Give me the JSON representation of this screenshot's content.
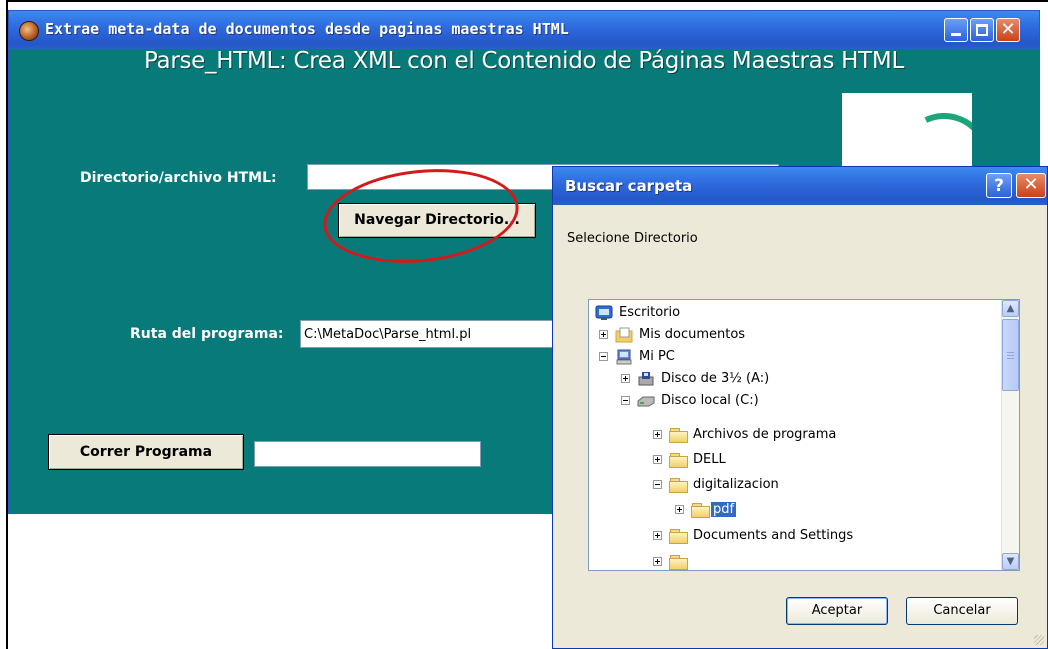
{
  "main_window": {
    "title": "Extrae meta-data de documentos desde paginas maestras HTML",
    "heading": "Parse_HTML: Crea XML con el Contenido de Páginas Maestras HTML",
    "dir_label": "Directorio/archivo HTML:",
    "dir_value": "",
    "browse_button": "Navegar Directorio...",
    "path_label": "Ruta del programa:",
    "path_value": "C:\\MetaDoc\\Parse_html.pl",
    "run_button": "Correr Programa",
    "run_status": "",
    "colors": {
      "client_bg": "#087a7a",
      "titlebar": "#2e6ce0",
      "highlight_oval": "#d31a1a"
    }
  },
  "dialog": {
    "title": "Buscar carpeta",
    "help_glyph": "?",
    "prompt": "Selecione Directorio",
    "tree": [
      {
        "label": "Escritorio",
        "icon": "desktop-icon",
        "expander": "none"
      },
      {
        "label": "Mis documentos",
        "icon": "my-documents-icon",
        "expander": "plus"
      },
      {
        "label": "Mi PC",
        "icon": "my-computer-icon",
        "expander": "minus"
      },
      {
        "label": "Disco de 3½ (A:)",
        "icon": "floppy-drive-icon",
        "expander": "plus"
      },
      {
        "label": "Disco local (C:)",
        "icon": "hard-drive-icon",
        "expander": "minus"
      },
      {
        "label": "Archivos de programa",
        "icon": "folder-icon",
        "expander": "plus"
      },
      {
        "label": "DELL",
        "icon": "folder-icon",
        "expander": "plus"
      },
      {
        "label": "digitalizacion",
        "icon": "folder-icon",
        "expander": "minus"
      },
      {
        "label": "pdf",
        "icon": "folder-icon",
        "expander": "plus",
        "selected": true
      },
      {
        "label": "Documents and Settings",
        "icon": "folder-icon",
        "expander": "plus"
      }
    ],
    "ok_button": "Aceptar",
    "cancel_button": "Cancelar"
  }
}
